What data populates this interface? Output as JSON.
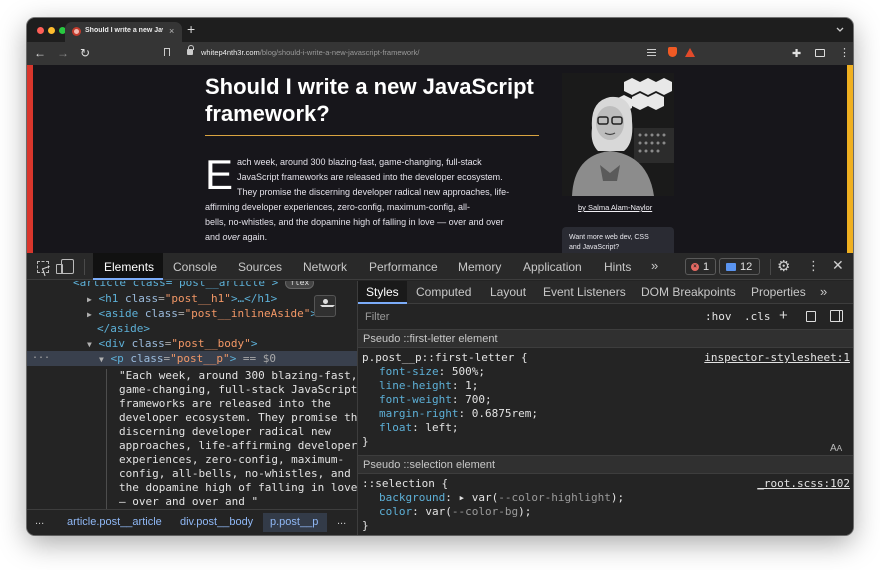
{
  "browser": {
    "tab_title": "Should I write a new JavaScri...",
    "tab_close": "×",
    "new_tab": "+",
    "url_host": "whitep4nth3r.com",
    "url_path": "/blog/should-i-write-a-new-javascript-framework/",
    "icons": [
      "back-icon",
      "forward-icon",
      "reload-icon",
      "bookmark-icon",
      "lock-icon",
      "reader-icon",
      "brave-shield-icon",
      "rewards-icon",
      "extensions-icon",
      "media-icon",
      "menu-icon"
    ]
  },
  "page": {
    "headline": "Should I write a new JavaScript framework?",
    "drop_cap": "E",
    "body_lines": [
      "ach week, around 300 blazing-fast, game-changing, full-stack",
      "JavaScript frameworks are released into the developer ecosystem.",
      "They promise the discerning developer radical new approaches, life-",
      "affirming developer experiences, zero-config, maximum-config, all-",
      "bells, no-whistles, and the dopamine high of falling in love — over and over"
    ],
    "last_line_pre": "and ",
    "last_line_em": "over",
    "last_line_post": " again.",
    "byline": "by Salma Alam-Naylor",
    "promo_lines": [
      "Want more web dev, CSS",
      "and JavaScript?"
    ],
    "colors": {
      "left_bar": "#d9362c",
      "right_bar": "#f0b020",
      "background": "#17161b",
      "rule": "#d9a441"
    }
  },
  "devtools": {
    "tabs": [
      "Elements",
      "Console",
      "Sources",
      "Network",
      "Performance",
      "Memory",
      "Application",
      "Hints"
    ],
    "more": "»",
    "error_count": "1",
    "message_count": "12",
    "dom": {
      "article_tag": "<article class=\"post__article\">",
      "flex_badge": "flex",
      "h1": {
        "open": "<h1 ",
        "attr": "class",
        "val": "\"post__h1\"",
        "rest": ">…</h1>"
      },
      "aside": {
        "open": "<aside ",
        "attr": "class",
        "val": "\"post__inlineAside\"",
        "rest": ">…"
      },
      "aside_close": "</aside>",
      "div": {
        "open": "<div ",
        "attr": "class",
        "val": "\"post__body\"",
        "rest": ">"
      },
      "p": {
        "open": "<p ",
        "attr": "class",
        "val": "\"post__p\"",
        "rest": ">",
        "eq": " == $0"
      },
      "text_lines": [
        "\"Each week, around 300 blazing-fast,",
        "game-changing, full-stack JavaScript",
        "frameworks are released into the",
        "developer ecosystem. They promise the",
        "discerning developer radical new",
        "approaches, life-affirming developer",
        "experiences, zero-config, maximum-",
        "config, all-bells, no-whistles, and",
        "the dopamine high of falling in love",
        "— over and over and \""
      ],
      "ellipsis": "..."
    },
    "breadcrumbs": [
      "article.post__article",
      "div.post__body",
      "p.post__p"
    ],
    "crumb_ellipsis": "...",
    "styles_tabs": [
      "Styles",
      "Computed",
      "Layout",
      "Event Listeners",
      "DOM Breakpoints",
      "Properties"
    ],
    "filter_placeholder": "Filter",
    "hov": ":hov",
    "cls": ".cls",
    "pseudo_first_letter_header": "Pseudo ::first-letter element",
    "first_letter_selector": "p.post__p::first-letter {",
    "first_letter_source": "inspector-stylesheet:1",
    "first_letter_props": [
      {
        "name": "font-size",
        "value": "500%;"
      },
      {
        "name": "line-height",
        "value": "1;"
      },
      {
        "name": "font-weight",
        "value": "700;"
      },
      {
        "name": "margin-right",
        "value": "0.6875rem;"
      },
      {
        "name": "float",
        "value": "left;"
      }
    ],
    "close_brace": "}",
    "pseudo_selection_header": "Pseudo ::selection element",
    "selection_selector": "::selection {",
    "selection_source": "_root.scss:102",
    "selection_props": [
      {
        "name": "background",
        "pre": "▸ var(",
        "var": "--color-highlight",
        "post": ");"
      },
      {
        "name": "color",
        "pre": "var(",
        "var": "--color-bg",
        "post": ");"
      }
    ]
  }
}
